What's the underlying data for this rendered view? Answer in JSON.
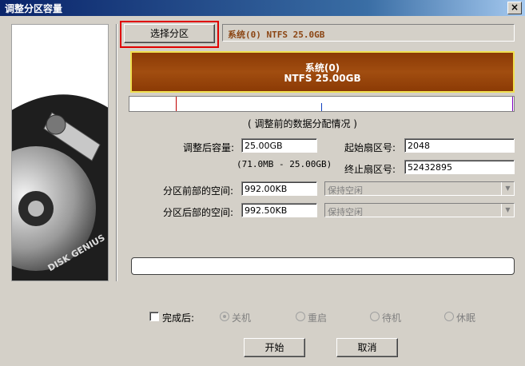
{
  "window": {
    "title": "调整分区容量",
    "close_glyph": "×"
  },
  "logo_text": "DISK GENIUS",
  "select_button": "选择分区",
  "partition_info": "系统(0) NTFS 25.0GB",
  "partition_bar": {
    "line1": "系统(0)",
    "line2": "NTFS 25.00GB"
  },
  "caption": "( 调整前的数据分配情况 )",
  "fields": {
    "size_label": "调整后容量:",
    "size_value": "25.00GB",
    "size_range": "(71.0MB - 25.00GB)",
    "start_label": "起始扇区号:",
    "start_value": "2048",
    "end_label": "终止扇区号:",
    "end_value": "52432895",
    "before_label": "分区前部的空间:",
    "before_value": "992.00KB",
    "before_option": "保持空闲",
    "after_label": "分区后部的空间:",
    "after_value": "992.50KB",
    "after_option": "保持空闲"
  },
  "after_done": {
    "label": "完成后:",
    "options": [
      "关机",
      "重启",
      "待机",
      "休眠"
    ],
    "selected": "关机"
  },
  "buttons": {
    "start": "开始",
    "cancel": "取消"
  },
  "colors": {
    "partition_fill": "#8b3a05",
    "partition_border": "#f0e050",
    "info_text": "#8b4513",
    "highlight": "#e00000"
  }
}
